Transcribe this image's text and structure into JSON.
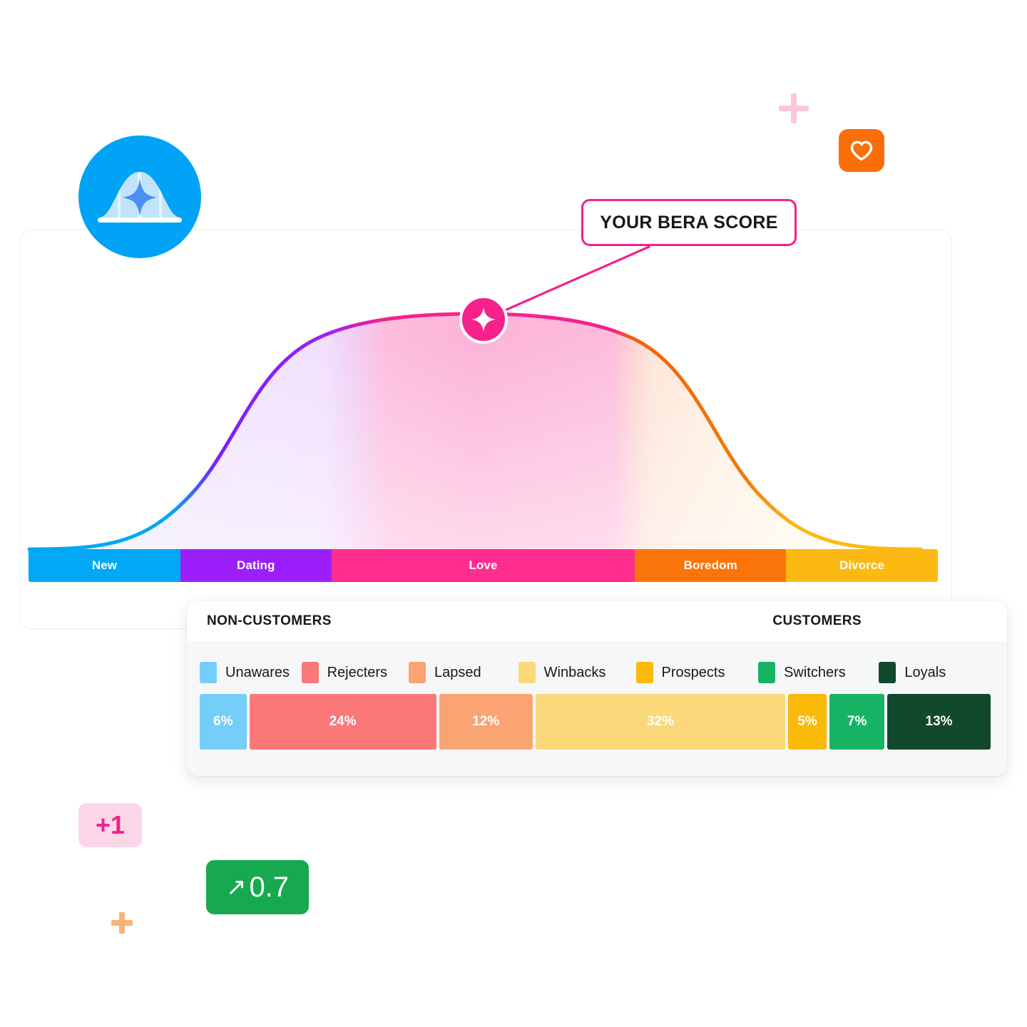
{
  "brand": {
    "logo_icon": "bell-curve-sparkle-icon",
    "logo_bg": "#00A3F5",
    "heart_icon": "heart-icon",
    "heart_bg": "#FB6E0A"
  },
  "decorations": {
    "plus_pink": {
      "icon": "plus-icon",
      "color": "#FBC8DB"
    },
    "plus_orange": {
      "icon": "plus-icon",
      "color": "#F9B277"
    }
  },
  "callout": {
    "label": "YOUR BERA SCORE",
    "border_color": "#F3218C",
    "marker_icon": "sparkle-icon",
    "marker_color": "#F7218C"
  },
  "stages": [
    {
      "label": "New",
      "color": "#00A8F5",
      "width_pct": 16.7
    },
    {
      "label": "Dating",
      "color": "#9B1FFB",
      "width_pct": 16.6
    },
    {
      "label": "Love",
      "color": "#FF2D8E",
      "width_pct": 33.4
    },
    {
      "label": "Boredom",
      "color": "#FB7409",
      "width_pct": 16.6
    },
    {
      "label": "Divorce",
      "color": "#FDB913",
      "width_pct": 16.7
    }
  ],
  "segments_card": {
    "left_title": "NON-CUSTOMERS",
    "right_title": "CUSTOMERS",
    "legend": [
      {
        "label": "Unawares",
        "color": "#74CEF8"
      },
      {
        "label": "Rejecters",
        "color": "#FA7878"
      },
      {
        "label": "Lapsed",
        "color": "#F9A472"
      },
      {
        "label": "Winbacks",
        "color": "#FBD97A"
      },
      {
        "label": "Prospects",
        "color": "#FBBA07"
      },
      {
        "label": "Switchers",
        "color": "#16B364"
      },
      {
        "label": "Loyals",
        "color": "#12492C"
      }
    ]
  },
  "pills": {
    "plus_one": "+1",
    "delta_arrow": "↗",
    "delta_value": "0.7",
    "plus_one_bg": "#FCD7E7",
    "plus_one_fg": "#F3218C",
    "delta_bg": "#17A94F"
  },
  "chart_data": {
    "type": "area",
    "title": "YOUR BERA SCORE",
    "xlabel": "",
    "ylabel": "",
    "distribution": "normal bell curve",
    "categories": [
      "New",
      "Dating",
      "Love",
      "Boredom",
      "Divorce"
    ],
    "stage_colors": [
      "#00A8F5",
      "#9B1FFB",
      "#FF2D8E",
      "#FB7409",
      "#FDB913"
    ],
    "stage_widths_pct": [
      16.7,
      16.6,
      33.4,
      16.6,
      16.7
    ],
    "marker": {
      "label": "YOUR BERA SCORE",
      "stage": "Love",
      "x_pct": 50,
      "y_pct": 100
    },
    "segmentation": {
      "type": "bar",
      "orientation": "stacked-horizontal",
      "groups": [
        "NON-CUSTOMERS",
        "CUSTOMERS"
      ],
      "categories": [
        "Unawares",
        "Rejecters",
        "Lapsed",
        "Winbacks",
        "Prospects",
        "Switchers",
        "Loyals"
      ],
      "values": [
        6,
        24,
        12,
        32,
        5,
        7,
        13
      ],
      "value_labels": [
        "6%",
        "24%",
        "12%",
        "32%",
        "5%",
        "7%",
        "13%"
      ],
      "colors": [
        "#74CEF8",
        "#FA7878",
        "#F9A472",
        "#FBD97A",
        "#FBBA07",
        "#16B364",
        "#12492C"
      ],
      "group_split_after": "Winbacks",
      "unit": "%"
    },
    "metrics": [
      {
        "label": "+1",
        "color": "#F3218C"
      },
      {
        "label": "0.7",
        "direction": "up",
        "color": "#17A94F"
      }
    ]
  }
}
